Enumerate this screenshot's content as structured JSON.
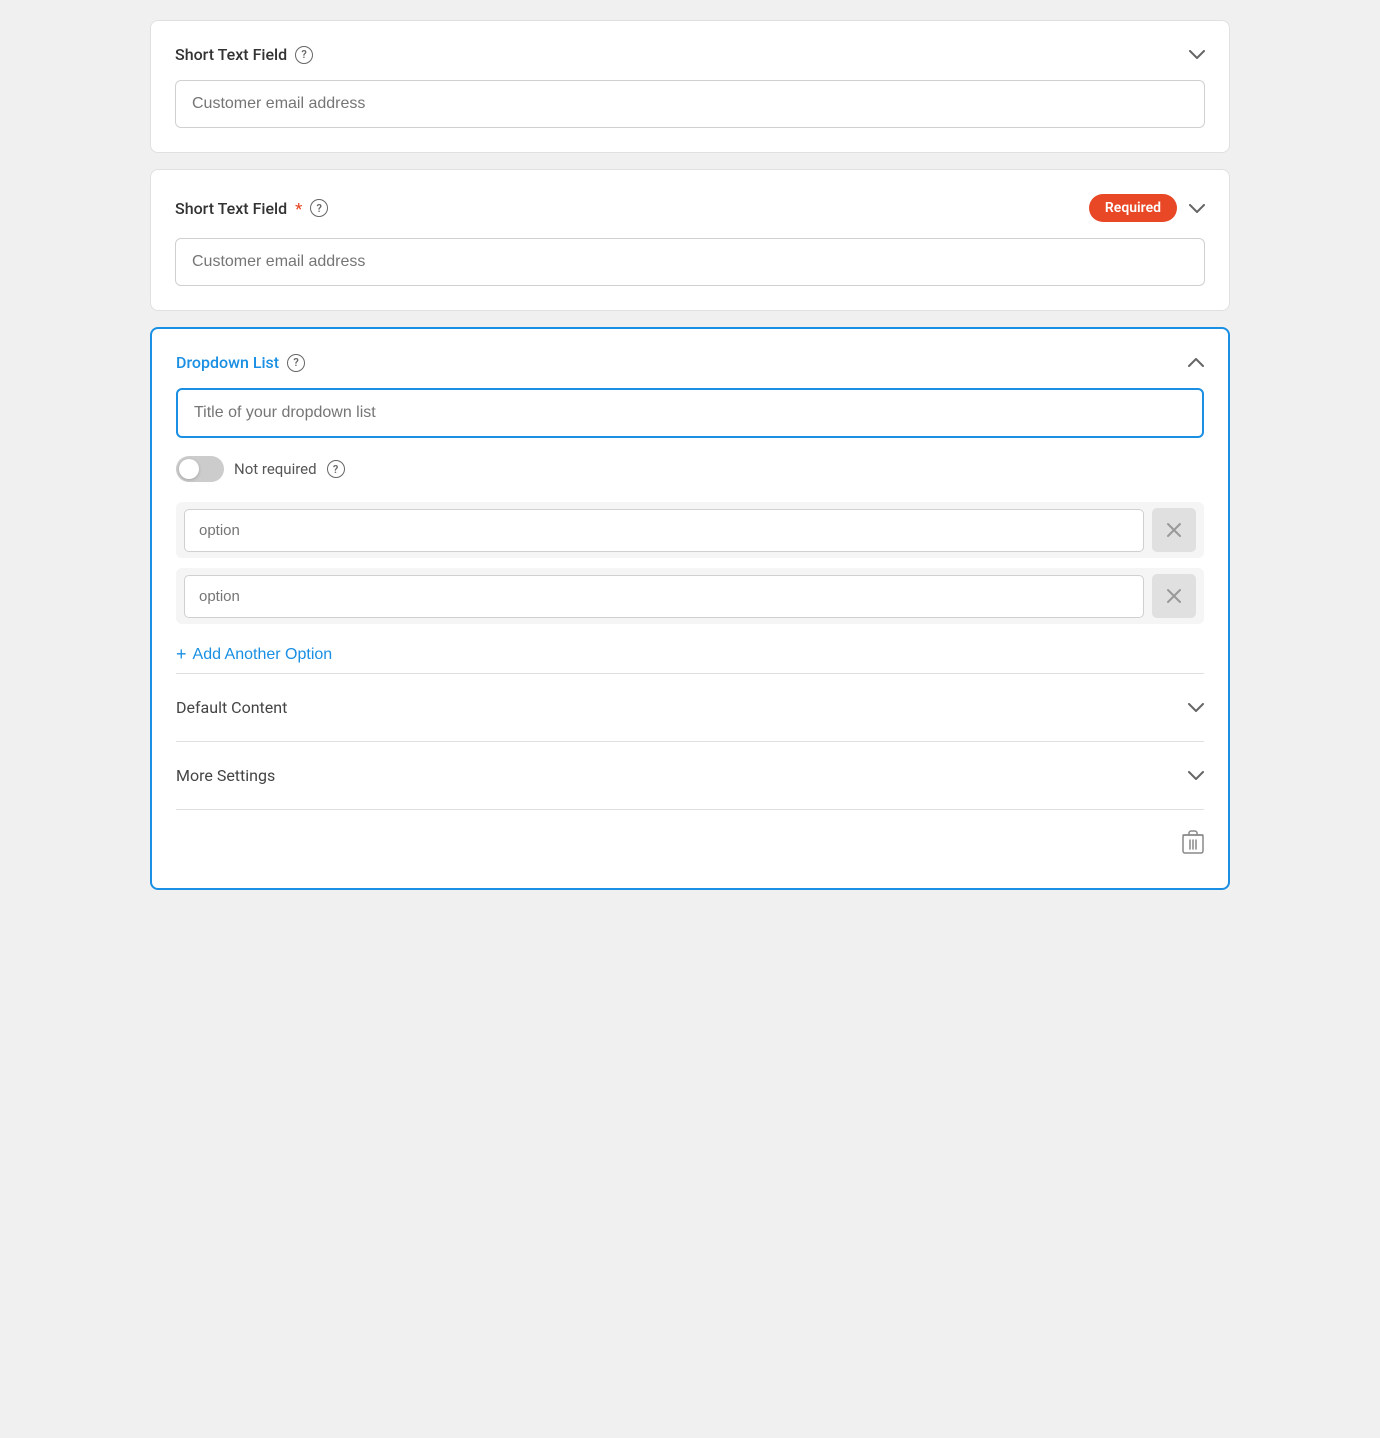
{
  "card1": {
    "title": "Short Text Field",
    "placeholder": "Customer email address",
    "chevron": "›",
    "has_required": false
  },
  "card2": {
    "title": "Short Text Field",
    "placeholder": "Customer email address",
    "chevron": "›",
    "has_required": true,
    "required_label": "Required"
  },
  "card3": {
    "title": "Dropdown List",
    "title_placeholder": "Title of your dropdown list",
    "toggle_label": "Not required",
    "options": [
      {
        "placeholder": "option"
      },
      {
        "placeholder": "option"
      }
    ],
    "add_option_label": "Add Another Option",
    "sections": [
      {
        "label": "Default Content"
      },
      {
        "label": "More Settings"
      }
    ]
  },
  "icons": {
    "help": "?",
    "chevron_down": "∨",
    "chevron_up": "∧",
    "plus": "+",
    "trash": "🗑"
  }
}
